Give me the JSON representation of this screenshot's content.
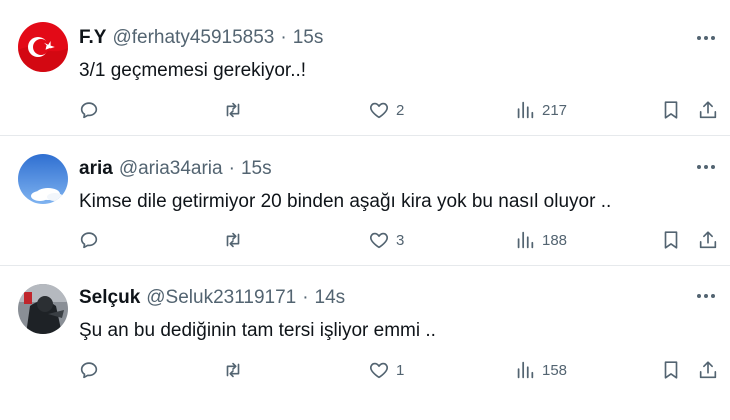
{
  "tweets": [
    {
      "name": "F.Y",
      "handle": "@ferhaty45915853",
      "dot": "·",
      "time": "15s",
      "text": "3/1 geçmemesi gerekiyor..!",
      "likes": "2",
      "views": "217",
      "avatar": "turkish-flag-avatar"
    },
    {
      "name": "aria",
      "handle": "@aria34aria",
      "dot": "·",
      "time": "15s",
      "text": "Kimse dile getirmiyor 20 binden aşağı kira yok bu nasıl oluyor ..",
      "likes": "3",
      "views": "188",
      "avatar": "sky-cloud-avatar"
    },
    {
      "name": "Selçuk",
      "handle": "@Seluk23119171",
      "dot": "·",
      "time": "14s",
      "text": "Şu an bu dediğinin tam tersi işliyor emmi ..",
      "likes": "1",
      "views": "158",
      "avatar": "dark-figure-avatar"
    }
  ],
  "colors": {
    "text": "#0f1419",
    "secondary": "#536471",
    "divider": "#e6e9ec",
    "flag_red": "#e30a17"
  }
}
